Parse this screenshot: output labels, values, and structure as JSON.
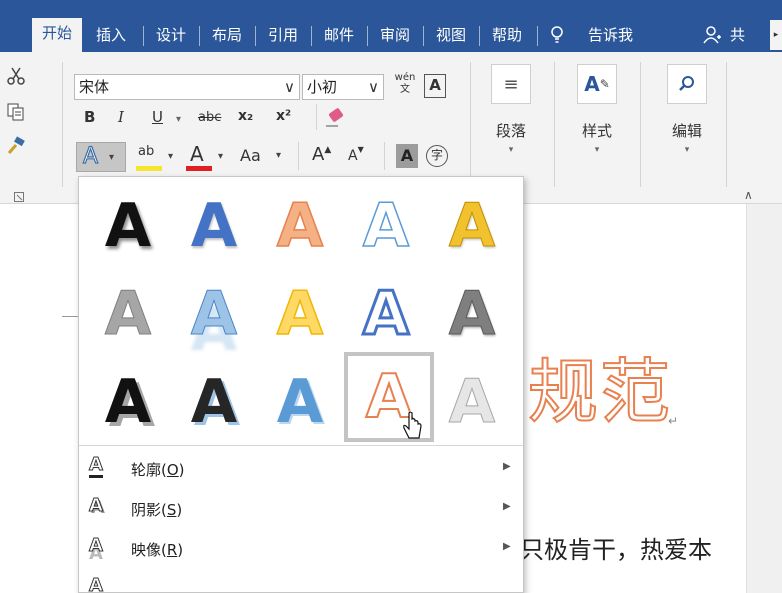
{
  "tabs": [
    {
      "label": "开始",
      "active": true
    },
    {
      "label": "插入"
    },
    {
      "label": "设计"
    },
    {
      "label": "布局"
    },
    {
      "label": "引用"
    },
    {
      "label": "邮件"
    },
    {
      "label": "审阅"
    },
    {
      "label": "视图"
    },
    {
      "label": "帮助"
    }
  ],
  "tell_me": {
    "icon": "lightbulb-icon",
    "label": "告诉我"
  },
  "share": {
    "icon": "person-add-icon",
    "label": "共"
  },
  "ribbon": {
    "font_name": "宋体",
    "font_size": "小初",
    "phonetic_guide": "wén文",
    "char_border": "A",
    "buttons": {
      "bold": "B",
      "italic": "I",
      "underline": "U",
      "strikethrough": "abc",
      "subscript": "x₂",
      "superscript": "x²",
      "change_case": "Aa",
      "grow_font": "A",
      "shrink_font": "A",
      "char_shading": "A",
      "enclose_char": "字"
    },
    "paragraph_label": "段落",
    "styles_label": "样式",
    "editing_label": "编辑",
    "colors": {
      "highlight": "#f5e52e",
      "font_color": "#e02020",
      "accent": "#2b579a"
    }
  },
  "document": {
    "title_fragment": "规范",
    "title_color": "#e8804f",
    "body_fragment": "只极肯干，热爱本",
    "paragraph_mark": "↵"
  },
  "text_effects_gallery": {
    "glyph": "A",
    "rows": [
      [
        {
          "style": "black-shadow"
        },
        {
          "style": "blue-fill"
        },
        {
          "style": "orange-gradient"
        },
        {
          "style": "white-blue-outline"
        },
        {
          "style": "gold-gradient"
        }
      ],
      [
        {
          "style": "gray-fill-outline"
        },
        {
          "style": "blue-reflection"
        },
        {
          "style": "yellow-gradient"
        },
        {
          "style": "white-blue-double-outline"
        },
        {
          "style": "gray-gradient"
        }
      ],
      [
        {
          "style": "black-thick-shadow"
        },
        {
          "style": "black-blue-shadow"
        },
        {
          "style": "blue-bevel"
        },
        {
          "style": "orange-outline",
          "selected": true
        },
        {
          "style": "light-gray-gradient"
        }
      ]
    ],
    "menu": [
      {
        "label": "轮廓(",
        "key": "O",
        "end": ")",
        "icon": "outline-icon"
      },
      {
        "label": "阴影(",
        "key": "S",
        "end": ")",
        "icon": "shadow-icon"
      },
      {
        "label": "映像(",
        "key": "R",
        "end": ")",
        "icon": "reflection-icon"
      }
    ]
  }
}
